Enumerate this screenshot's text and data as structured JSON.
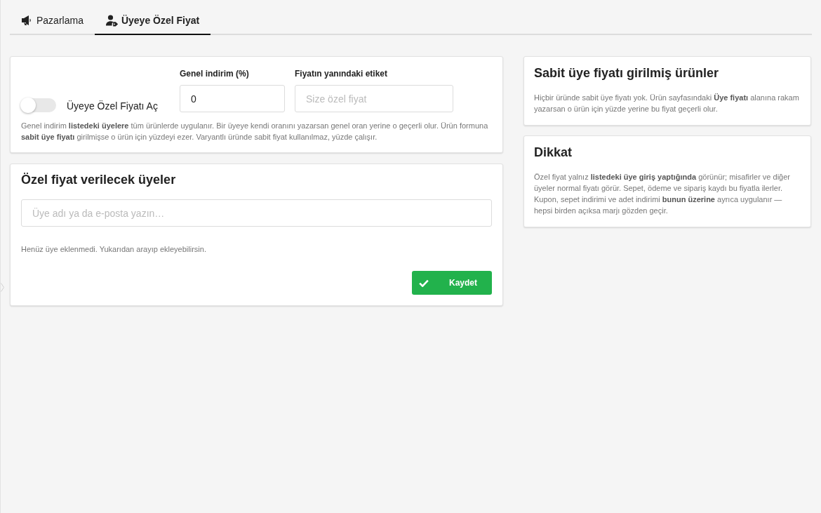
{
  "tabs": [
    {
      "label": "Pazarlama",
      "selected": false
    },
    {
      "label": "Üyeye Özel Fiyat",
      "selected": true
    }
  ],
  "settings": {
    "toggle": {
      "label": "Üyeye Özel Fiyatı Aç",
      "on": false
    },
    "fields": [
      {
        "label": "Genel indirim (%)",
        "value": "0"
      },
      {
        "label": "Fiyatın yanındaki etiket",
        "placeholder": "Size özel fiyat"
      }
    ],
    "help": "Genel indirim **listedeki üyelere** tüm ürünlerde uygulanır. Bir üyeye kendi oranını yazarsan genel oran yerine o geçerli olur. Ürün formuna **sabit üye fiyatı** girilmişse o ürün için yüzdeyi ezer. Varyantlı üründe sabit fiyat kullanılmaz, yüzde çalışır."
  },
  "members": {
    "title": "Özel fiyat verilecek üyeler",
    "search": {
      "placeholder": "Üye adı ya da e-posta yazın…"
    },
    "empty_text": "Henüz üye eklenmedi. Yukarıdan arayıp ekleyebilirsin.",
    "save_button": "Kaydet"
  },
  "info_cards": [
    {
      "title": "Sabit üye fiyatı girilmiş ürünler",
      "text": "Hiçbir üründe sabit üye fiyatı yok. Ürün sayfasındaki **Üye fiyatı** alanına rakam yazarsan o ürün için yüzde yerine bu fiyat geçerli olur."
    },
    {
      "title": "Dikkat",
      "text": "Özel fiyat yalnız **listedeki üye giriş yaptığında** görünür; misafirler ve diğer üyeler normal fiyatı görür. Sepet, ödeme ve sipariş kaydı bu fiyatla ilerler. Kupon, sepet indirimi ve adet indirimi **bunun üzerine** ayrıca uygulanır — hepsi birden açıksa marjı gözden geçir."
    }
  ]
}
